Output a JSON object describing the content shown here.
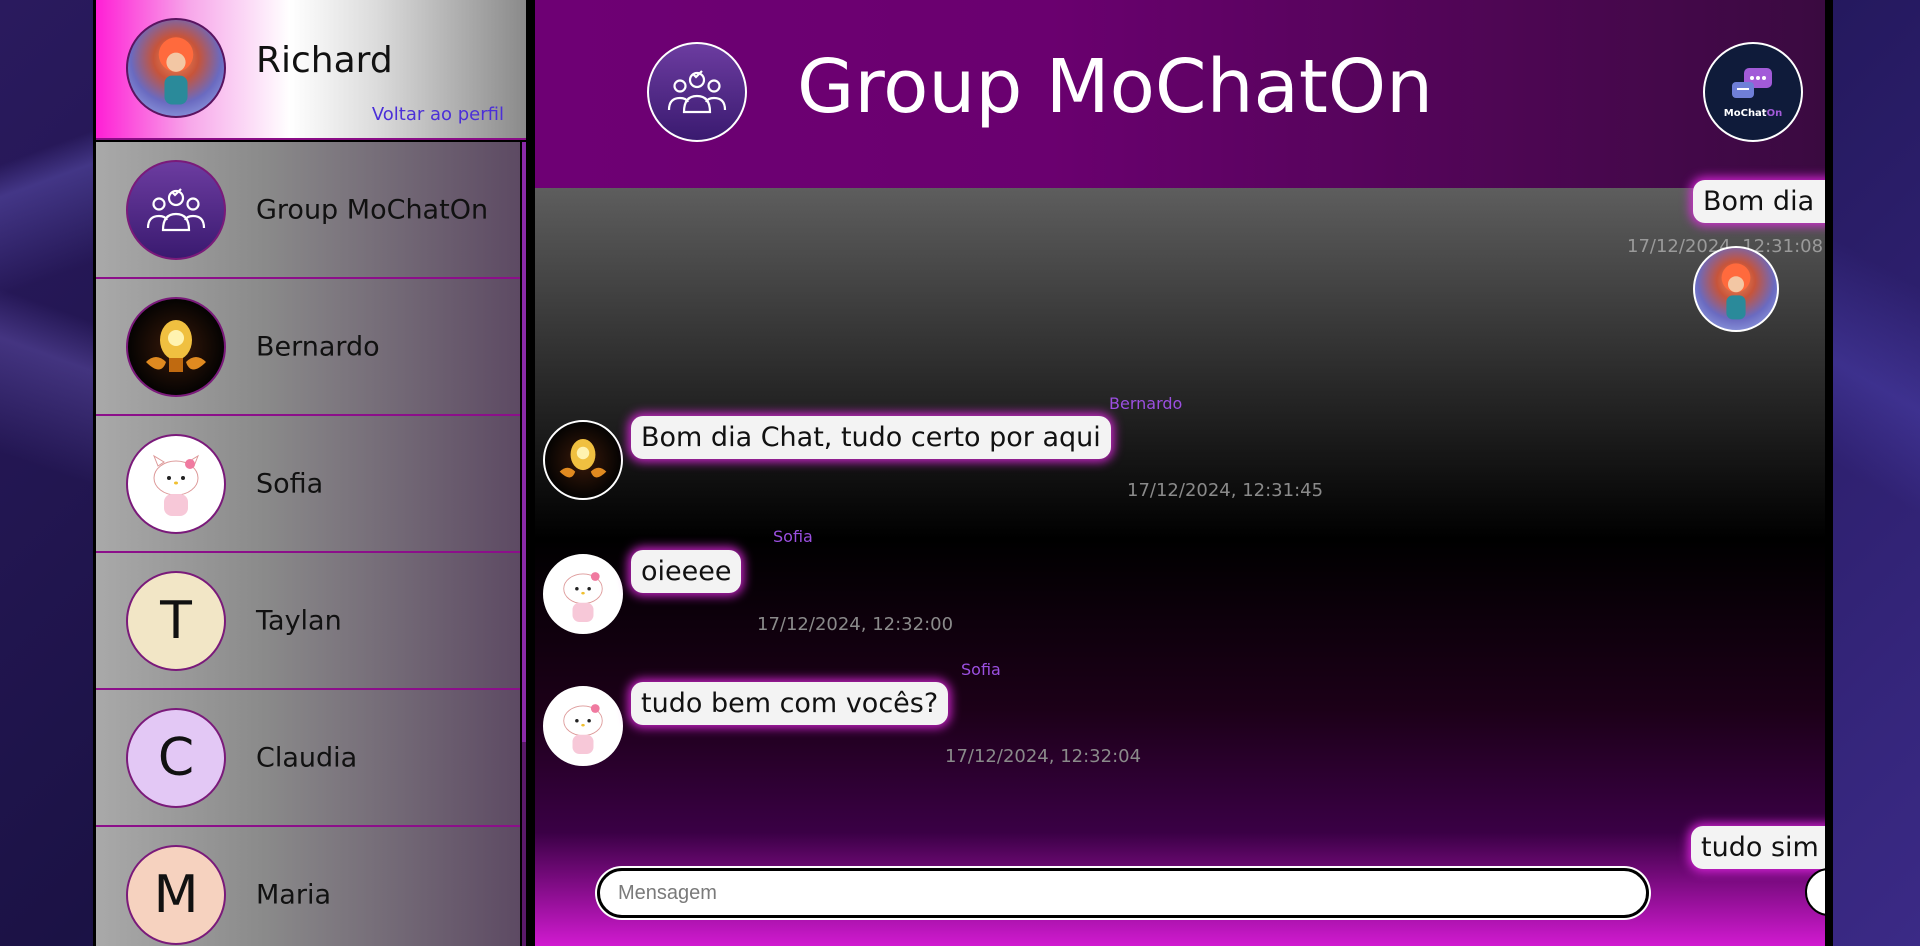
{
  "profile": {
    "name": "Richard",
    "back_link": "Voltar ao perfil"
  },
  "contacts": [
    {
      "name": "Group MoChatOn",
      "avatar": "group-icon",
      "color": "#4a1a80"
    },
    {
      "name": "Bernardo",
      "avatar": "robot-avatar",
      "color": "#120a05"
    },
    {
      "name": "Sofia",
      "avatar": "hello-kitty-avatar",
      "color": "#ffffff"
    },
    {
      "name": "Taylan",
      "avatar_letter": "T",
      "color": "#f2e6c6"
    },
    {
      "name": "Claudia",
      "avatar_letter": "C",
      "color": "#e3c8f5"
    },
    {
      "name": "Maria",
      "avatar_letter": "M",
      "color": "#f6d2bf"
    }
  ],
  "header": {
    "title": "Group MoChatOn",
    "logo_text_main": "MoChat",
    "logo_text_accent": "On"
  },
  "messages": [
    {
      "sender": "",
      "text": "Bom dia :)",
      "time": "17/12/2024, 12:31:08",
      "own": true
    },
    {
      "sender": "Bernardo",
      "text": "Bom dia Chat, tudo certo por aqui",
      "time": "17/12/2024, 12:31:45",
      "own": false
    },
    {
      "sender": "Sofia",
      "text": "oieeee",
      "time": "17/12/2024, 12:32:00",
      "own": false
    },
    {
      "sender": "Sofia",
      "text": "tudo bem com vocês?",
      "time": "17/12/2024, 12:32:04",
      "own": false
    },
    {
      "sender": "",
      "text": "tudo sim :)",
      "time": "",
      "own": true
    }
  ],
  "composer": {
    "placeholder": "Mensagem",
    "send_label": ">"
  },
  "colors": {
    "accent": "#ff1fd5",
    "header": "#6e0074",
    "link": "#4b2fd8"
  }
}
